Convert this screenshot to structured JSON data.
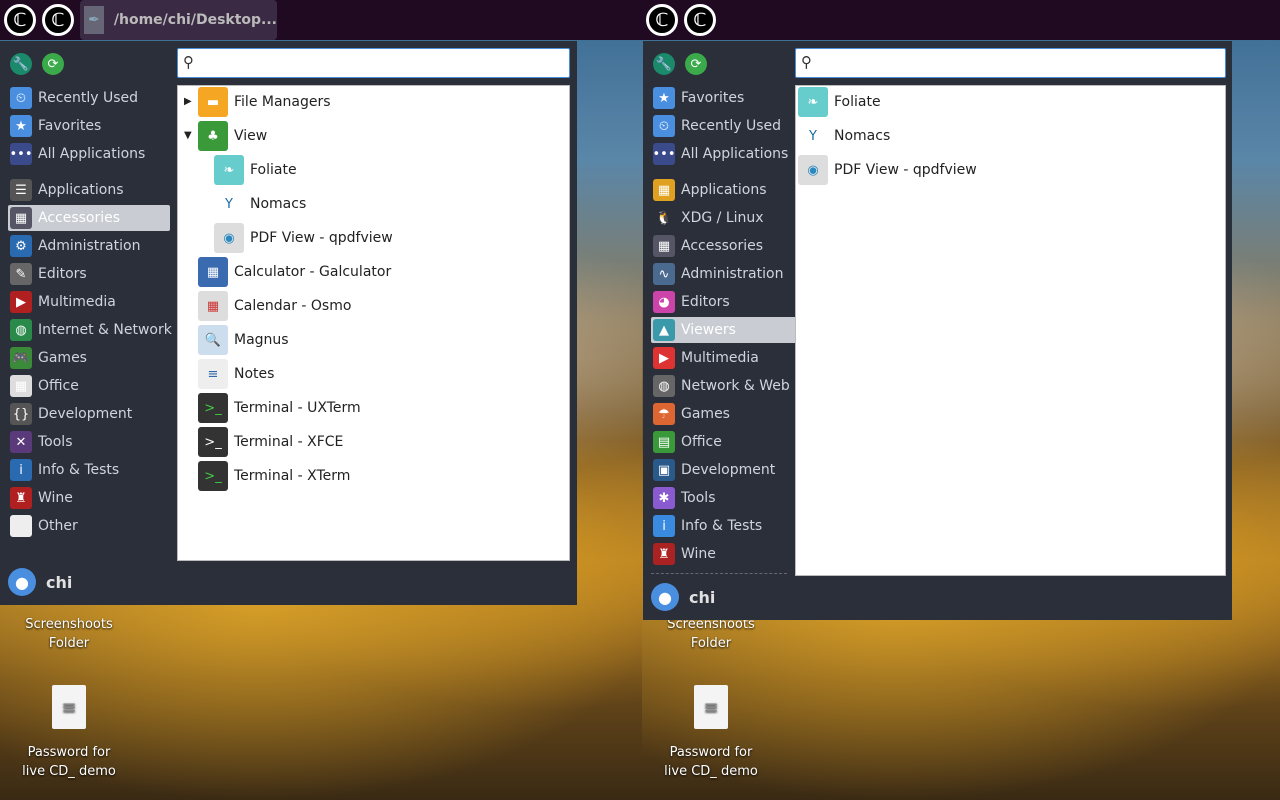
{
  "topbar": {
    "task_title": "/home/chi/Desktop..."
  },
  "left": {
    "favorites": [
      {
        "label": "Recently Used",
        "color": "#4a8ee0",
        "glyph": "⏲"
      },
      {
        "label": "Favorites",
        "color": "#4a8ee0",
        "glyph": "★"
      },
      {
        "label": "All Applications",
        "color": "#3a4a8a",
        "glyph": "•••"
      }
    ],
    "categories": [
      {
        "label": "Applications",
        "color": "#555",
        "glyph": "☰"
      },
      {
        "label": "Accessories",
        "color": "#556",
        "glyph": "▦",
        "selected": true
      },
      {
        "label": "Administration",
        "color": "#2a6ab0",
        "glyph": "⚙"
      },
      {
        "label": "Editors",
        "color": "#666",
        "glyph": "✎"
      },
      {
        "label": "Multimedia",
        "color": "#b02020",
        "glyph": "▶"
      },
      {
        "label": "Internet & Network",
        "color": "#2a8a4a",
        "glyph": "◍"
      },
      {
        "label": "Games",
        "color": "#3a8a3a",
        "glyph": "🎮"
      },
      {
        "label": "Office",
        "color": "#ddd",
        "glyph": "▦"
      },
      {
        "label": "Development",
        "color": "#555",
        "glyph": "{}"
      },
      {
        "label": "Tools",
        "color": "#5a3a7a",
        "glyph": "✕"
      },
      {
        "label": "Info & Tests",
        "color": "#2a6ab0",
        "glyph": "i"
      },
      {
        "label": "Wine",
        "color": "#b02020",
        "glyph": "♜"
      },
      {
        "label": "Other",
        "color": "#eee",
        "glyph": ""
      }
    ],
    "search_placeholder": "",
    "items": [
      {
        "label": "File Managers",
        "indent": 0,
        "arrow": "▶",
        "color": "#f5a623",
        "glyph": "▬"
      },
      {
        "label": "View",
        "indent": 0,
        "arrow": "▼",
        "color": "#3a9a3a",
        "glyph": "♣"
      },
      {
        "label": "Foliate",
        "indent": 1,
        "color": "#6cc",
        "glyph": "❧"
      },
      {
        "label": "Nomacs",
        "indent": 1,
        "color": "#fff",
        "glyph": "Y",
        "fg": "#1a6aa0"
      },
      {
        "label": "PDF View - qpdfview",
        "indent": 1,
        "color": "#ddd",
        "glyph": "◉",
        "fg": "#2a8ac0"
      },
      {
        "label": "Calculator - Galculator",
        "indent": 0,
        "color": "#3a6ab0",
        "glyph": "▦"
      },
      {
        "label": "Calendar - Osmo",
        "indent": 0,
        "color": "#ddd",
        "glyph": "▦",
        "fg": "#c33"
      },
      {
        "label": "Magnus",
        "indent": 0,
        "color": "#cde",
        "glyph": "🔍"
      },
      {
        "label": "Notes",
        "indent": 0,
        "color": "#eee",
        "glyph": "≡",
        "fg": "#36a"
      },
      {
        "label": "Terminal - UXTerm",
        "indent": 0,
        "color": "#333",
        "glyph": ">_",
        "fg": "#4c4"
      },
      {
        "label": "Terminal - XFCE",
        "indent": 0,
        "color": "#333",
        "glyph": ">_"
      },
      {
        "label": "Terminal - XTerm",
        "indent": 0,
        "color": "#333",
        "glyph": ">_",
        "fg": "#4c4"
      }
    ],
    "user": "chi"
  },
  "right": {
    "favorites": [
      {
        "label": "Favorites",
        "color": "#4a8ee0",
        "glyph": "★"
      },
      {
        "label": "Recently Used",
        "color": "#4a8ee0",
        "glyph": "⏲"
      },
      {
        "label": "All Applications",
        "color": "#3a4a8a",
        "glyph": "•••"
      }
    ],
    "categories": [
      {
        "label": "Applications",
        "color": "#e0a020",
        "glyph": "▦"
      },
      {
        "label": "XDG / Linux",
        "color": "#2b2f3a",
        "glyph": "🐧"
      },
      {
        "label": "Accessories",
        "color": "#556",
        "glyph": "▦"
      },
      {
        "label": "Administration",
        "color": "#4a6a90",
        "glyph": "∿"
      },
      {
        "label": "Editors",
        "color": "#c4a",
        "glyph": "◕"
      },
      {
        "label": "Viewers",
        "color": "#3a9aaa",
        "glyph": "▲",
        "selected": true
      },
      {
        "label": "Multimedia",
        "color": "#d33",
        "glyph": "▶"
      },
      {
        "label": "Network & Web",
        "color": "#666",
        "glyph": "◍"
      },
      {
        "label": "Games",
        "color": "#d63",
        "glyph": "☂"
      },
      {
        "label": "Office",
        "color": "#3a9a3a",
        "glyph": "▤"
      },
      {
        "label": "Development",
        "color": "#2a5a8a",
        "glyph": "▣"
      },
      {
        "label": "Tools",
        "color": "#8a5ad0",
        "glyph": "✱"
      },
      {
        "label": "Info & Tests",
        "color": "#3a8ae0",
        "glyph": "i"
      },
      {
        "label": "Wine",
        "color": "#a22",
        "glyph": "♜"
      }
    ],
    "search_placeholder": "",
    "items": [
      {
        "label": "Foliate",
        "indent": 0,
        "color": "#6cc",
        "glyph": "❧"
      },
      {
        "label": "Nomacs",
        "indent": 0,
        "color": "#fff",
        "glyph": "Y",
        "fg": "#1a6aa0"
      },
      {
        "label": "PDF View - qpdfview",
        "indent": 0,
        "color": "#ddd",
        "glyph": "◉",
        "fg": "#2a8ac0"
      }
    ],
    "user": "chi"
  },
  "desktop": [
    {
      "label_line1": "Screenshoots",
      "label_line2": "Folder"
    },
    {
      "label_line1": "Password for",
      "label_line2": "live CD_ demo"
    }
  ]
}
